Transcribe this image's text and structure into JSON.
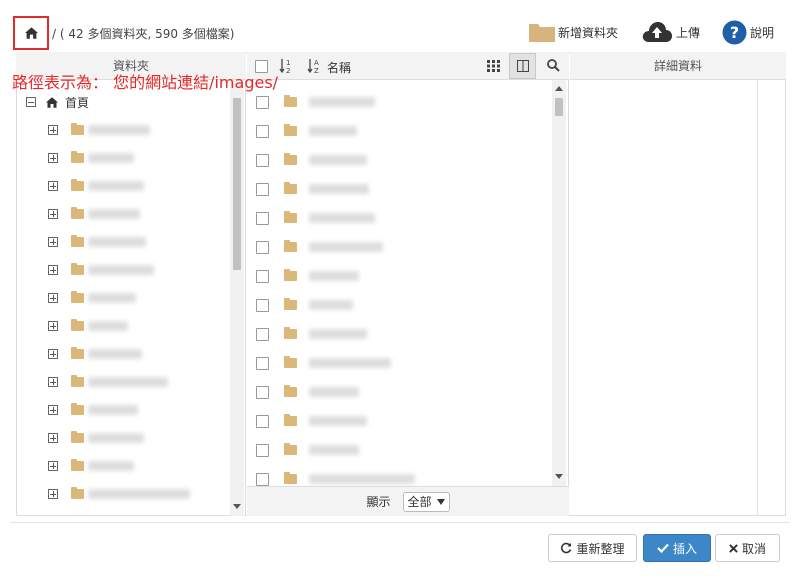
{
  "toolbar": {
    "path_text": "/ ( 42 多個資料夾, 590 多個檔案)",
    "new_folder_label": "新增資料夾",
    "upload_label": "上傳",
    "help_label": "說明"
  },
  "annotation": {
    "text": "路徑表示為： 您的網站連結/images/"
  },
  "folder_panel": {
    "header": "資料夾",
    "root_label": "首頁"
  },
  "file_panel": {
    "name_header": "名稱",
    "show_label": "顯示",
    "show_value": "全部"
  },
  "details_panel": {
    "header": "詳細資料"
  },
  "footer": {
    "refresh_label": "重新整理",
    "insert_label": "插入",
    "cancel_label": "取消"
  },
  "colors": {
    "accent": "#3d87c8",
    "annotation": "#e4292b",
    "folder": "#dbb77a",
    "help": "#1e5fa8"
  }
}
